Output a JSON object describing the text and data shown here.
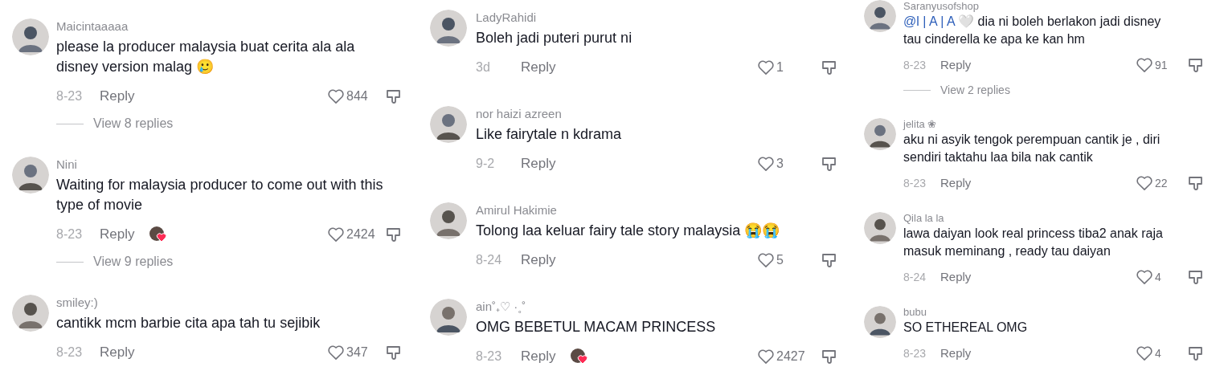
{
  "columns": [
    {
      "comments": [
        {
          "name": "Maicintaaaaa",
          "text": "please la producer malaysia buat cerita ala ala disney version malag 🥲",
          "date": "8-23",
          "reply": "Reply",
          "liked": false,
          "likes": "844",
          "creator_liked": false,
          "view_replies": "View 8 replies"
        },
        {
          "name": "Nini",
          "text": "Waiting for malaysia producer to come out with this type of movie",
          "date": "8-23",
          "reply": "Reply",
          "liked": false,
          "likes": "2424",
          "creator_liked": true,
          "view_replies": "View 9 replies"
        },
        {
          "name": "smiley:)",
          "text": "cantikk mcm barbie cita apa tah tu sejibik",
          "date": "8-23",
          "reply": "Reply",
          "liked": false,
          "likes": "347",
          "creator_liked": false
        }
      ]
    },
    {
      "comments": [
        {
          "name": "LadyRahidi",
          "text": "Boleh jadi puteri purut ni",
          "date": "3d",
          "reply": "Reply",
          "liked": false,
          "likes": "1",
          "creator_liked": false
        },
        {
          "name": "nor haizi azreen",
          "text": "Like fairytale n kdrama",
          "date": "9-2",
          "reply": "Reply",
          "liked": false,
          "likes": "3",
          "creator_liked": false
        },
        {
          "name": "Amirul Hakimie",
          "text": "Tolong laa keluar fairy tale story malaysia 😭😭",
          "date": "8-24",
          "reply": "Reply",
          "liked": false,
          "likes": "5",
          "creator_liked": false
        },
        {
          "name": "ain˚₊♡ ·˳˚",
          "text": "OMG BEBETUL MACAM PRINCESS",
          "date": "8-23",
          "reply": "Reply",
          "liked": false,
          "likes": "2427",
          "creator_liked": true
        }
      ]
    },
    {
      "comments": [
        {
          "name": "Saranyusofshop",
          "mention": "@l | A | A",
          "text": "🤍 dia ni boleh berlakon jadi disney tau cinderella ke apa ke kan hm",
          "date": "8-23",
          "reply": "Reply",
          "liked": false,
          "likes": "91",
          "creator_liked": false,
          "view_replies": "View 2 replies"
        },
        {
          "name": "jelita ❀",
          "text": "aku ni asyik tengok perempuan cantik je , diri sendiri taktahu laa bila nak cantik",
          "date": "8-23",
          "reply": "Reply",
          "liked": false,
          "likes": "22",
          "creator_liked": false
        },
        {
          "name": "Qila la la",
          "text": "lawa daiyan look real princess tiba2 anak raja masuk meminang , ready tau daiyan",
          "date": "8-24",
          "reply": "Reply",
          "liked": false,
          "likes": "4",
          "creator_liked": false
        },
        {
          "name": "bubu",
          "text": "SO ETHEREAL OMG",
          "date": "8-23",
          "reply": "Reply",
          "liked": false,
          "likes": "4",
          "creator_liked": false
        }
      ]
    }
  ]
}
